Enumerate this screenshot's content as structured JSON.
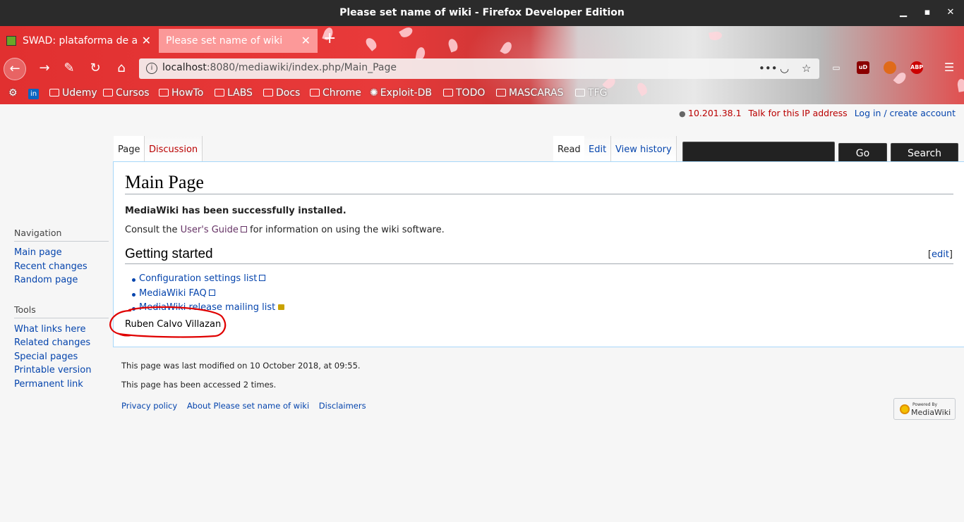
{
  "window": {
    "title": "Please set name of wiki - Firefox Developer Edition"
  },
  "browser": {
    "tabs": [
      {
        "label": "SWAD: plataforma de a",
        "active": false
      },
      {
        "label": "Please set name of wiki",
        "active": true
      }
    ],
    "url_host": "localhost",
    "url_rest": ":8080/mediawiki/index.php/Main_Page",
    "bookmarks": [
      "Udemy",
      "Cursos",
      "HowTo",
      "LABS",
      "Docs",
      "Chrome",
      "Exploit-DB",
      "TODO",
      "MASCARAS",
      "TFG"
    ],
    "extensions": [
      "uD",
      "ABP"
    ]
  },
  "personal": {
    "ip": "10.201.38.1",
    "talk": "Talk for this IP address",
    "login": "Log in / create account"
  },
  "page_tabs": {
    "page": "Page",
    "discussion": "Discussion",
    "read": "Read",
    "edit": "Edit",
    "history": "View history"
  },
  "search": {
    "go": "Go",
    "search": "Search"
  },
  "content": {
    "title": "Main Page",
    "installed": "MediaWiki has been successfully installed.",
    "consult_prefix": "Consult the",
    "users_guide": "User's Guide",
    "consult_suffix": "for information on using the wiki software.",
    "section_title": "Getting started",
    "section_edit": "edit",
    "links": [
      "Configuration settings list",
      "MediaWiki FAQ",
      "MediaWiki release mailing list"
    ],
    "author": "Ruben Calvo Villazan"
  },
  "sidebar": {
    "nav_heading": "Navigation",
    "nav_items": [
      "Main page",
      "Recent changes",
      "Random page"
    ],
    "tools_heading": "Tools",
    "tools_items": [
      "What links here",
      "Related changes",
      "Special pages",
      "Printable version",
      "Permanent link"
    ]
  },
  "footer": {
    "modified": "This page was last modified on 10 October 2018, at 09:55.",
    "accessed": "This page has been accessed 2 times.",
    "links": [
      "Privacy policy",
      "About Please set name of wiki",
      "Disclaimers"
    ],
    "powered_small": "Powered By",
    "powered_big": "MediaWiki"
  },
  "colors": {
    "link": "#0645ad",
    "new_link": "#ba0000",
    "visited_external": "#663366",
    "annotation": "#e00000"
  }
}
